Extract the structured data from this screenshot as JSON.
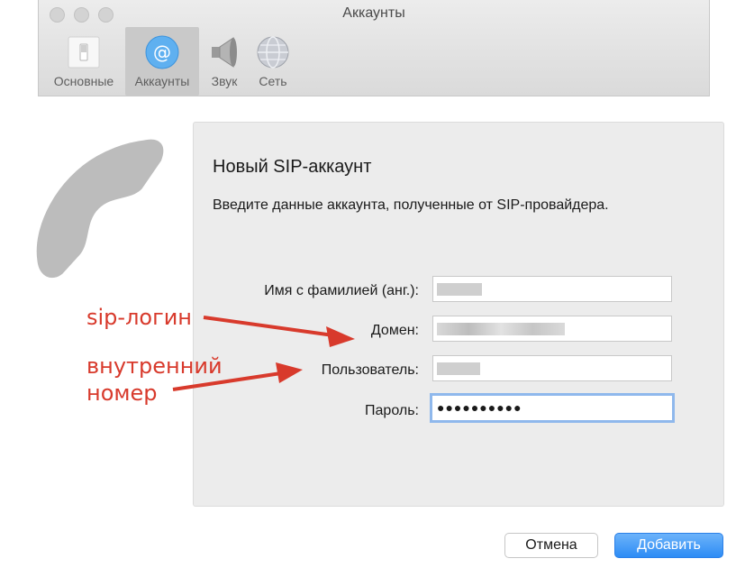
{
  "window": {
    "title": "Аккаунты"
  },
  "toolbar": {
    "items": [
      {
        "label": "Основные",
        "icon": "switch-icon",
        "active": false
      },
      {
        "label": "Аккаунты",
        "icon": "at-sign-icon",
        "active": true
      },
      {
        "label": "Звук",
        "icon": "speaker-icon",
        "active": false
      },
      {
        "label": "Сеть",
        "icon": "globe-icon",
        "active": false
      }
    ]
  },
  "panel": {
    "title": "Новый SIP-аккаунт",
    "subtitle": "Введите данные аккаунта, полученные от SIP-провайдера.",
    "fields": {
      "name": {
        "label": "Имя с фамилией (анг.):",
        "value": ""
      },
      "domain": {
        "label": "Домен:",
        "value": ""
      },
      "user": {
        "label": "Пользователь:",
        "value": ""
      },
      "password": {
        "label": "Пароль:",
        "value": "●●●●●●●●●●"
      }
    }
  },
  "annotations": {
    "sip_login": "sip-логин",
    "internal_line1": "внутренний",
    "internal_line2": "номер",
    "color": "#d83a2c"
  },
  "buttons": {
    "cancel": "Отмена",
    "add": "Добавить"
  },
  "colors": {
    "accent": "#2d8cf5",
    "focus_ring": "#8fb8ec"
  }
}
